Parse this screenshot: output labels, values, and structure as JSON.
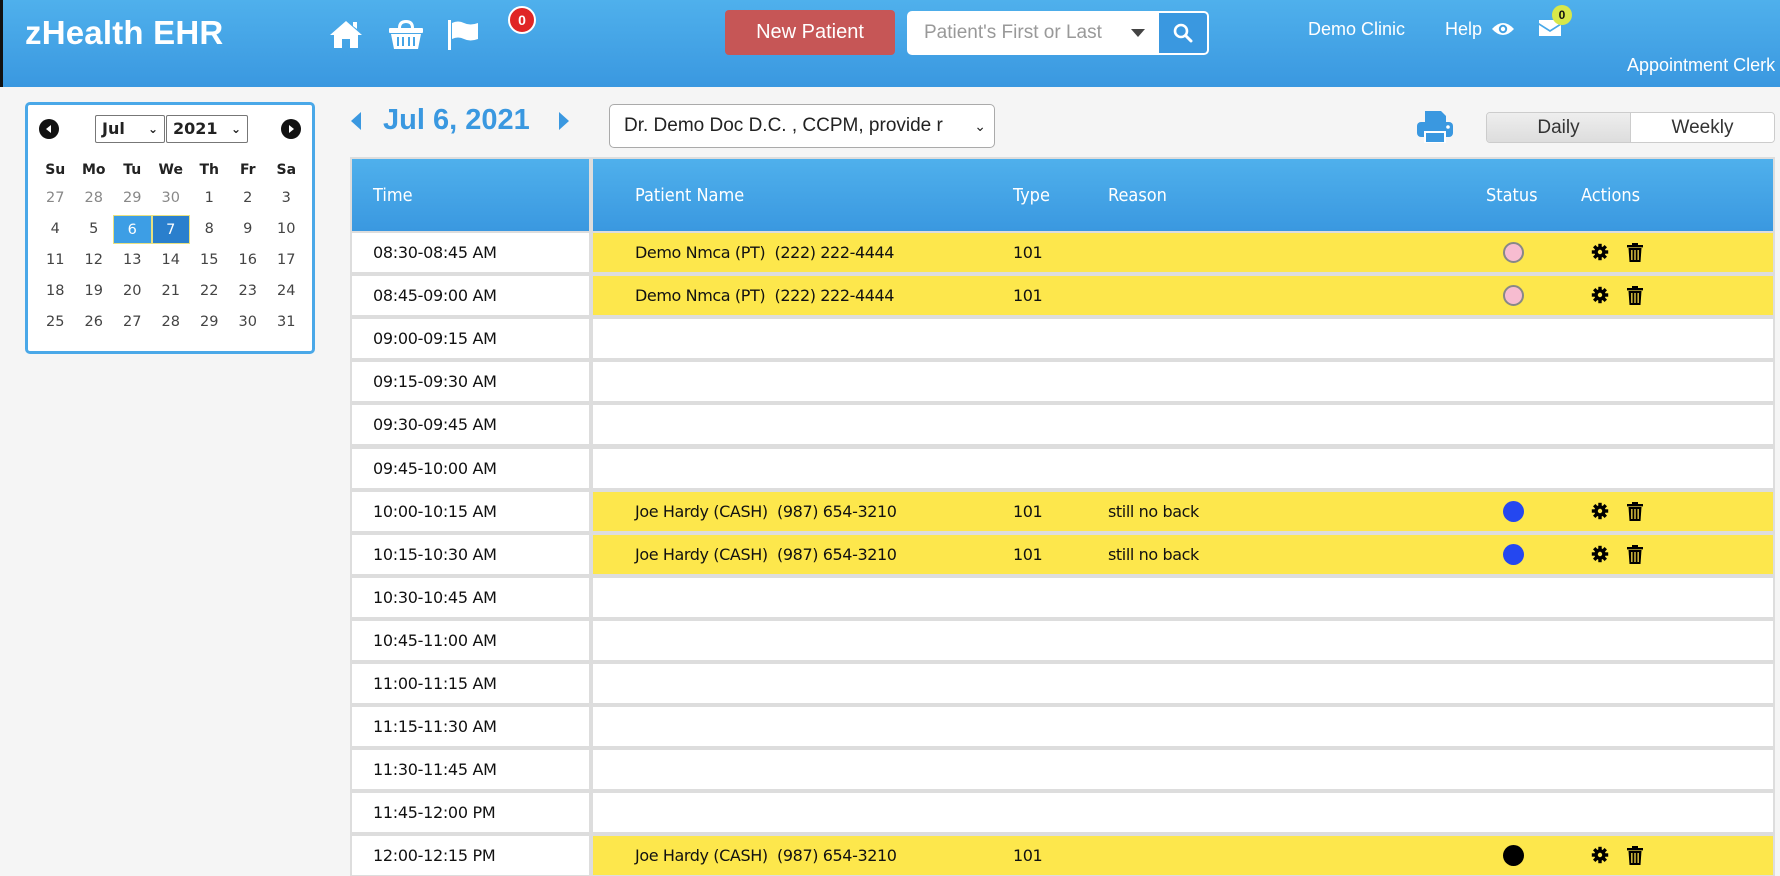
{
  "app": {
    "title": "zHealth EHR",
    "flags_badge": "0",
    "new_patient_label": "New Patient",
    "search_placeholder": "Patient's First or Last Name",
    "clinic": "Demo Clinic",
    "help": "Help",
    "messages_badge": "0",
    "role": "Appointment Clerk"
  },
  "calendar": {
    "month": "Jul",
    "year": "2021",
    "weekdays": [
      "Su",
      "Mo",
      "Tu",
      "We",
      "Th",
      "Fr",
      "Sa"
    ],
    "weeks": [
      [
        {
          "d": "27",
          "o": true
        },
        {
          "d": "28",
          "o": true
        },
        {
          "d": "29",
          "o": true
        },
        {
          "d": "30",
          "o": true
        },
        {
          "d": "1"
        },
        {
          "d": "2"
        },
        {
          "d": "3"
        }
      ],
      [
        {
          "d": "4"
        },
        {
          "d": "5"
        },
        {
          "d": "6",
          "s": "sel"
        },
        {
          "d": "7",
          "s": "today"
        },
        {
          "d": "8"
        },
        {
          "d": "9"
        },
        {
          "d": "10"
        }
      ],
      [
        {
          "d": "11"
        },
        {
          "d": "12"
        },
        {
          "d": "13"
        },
        {
          "d": "14"
        },
        {
          "d": "15"
        },
        {
          "d": "16"
        },
        {
          "d": "17"
        }
      ],
      [
        {
          "d": "18"
        },
        {
          "d": "19"
        },
        {
          "d": "20"
        },
        {
          "d": "21"
        },
        {
          "d": "22"
        },
        {
          "d": "23"
        },
        {
          "d": "24"
        }
      ],
      [
        {
          "d": "25"
        },
        {
          "d": "26"
        },
        {
          "d": "27"
        },
        {
          "d": "28"
        },
        {
          "d": "29"
        },
        {
          "d": "30"
        },
        {
          "d": "31"
        }
      ]
    ]
  },
  "schedule": {
    "date": "Jul 6, 2021",
    "provider": "Dr. Demo Doc D.C. , CCPM, provide r",
    "views": {
      "daily": "Daily",
      "weekly": "Weekly",
      "active": "Daily"
    },
    "columns": {
      "time": "Time",
      "patient": "Patient Name",
      "type": "Type",
      "reason": "Reason",
      "status": "Status",
      "actions": "Actions"
    },
    "status_colors": {
      "pink": "#f7bcd0",
      "blue": "#2447f0",
      "black": "#000000"
    },
    "rows": [
      {
        "time": "08:30-08:45 AM",
        "patient": "Demo Nmca (PT)  (222) 222-4444",
        "type": "101",
        "reason": "",
        "status": "pink"
      },
      {
        "time": "08:45-09:00 AM",
        "patient": "Demo Nmca (PT)  (222) 222-4444",
        "type": "101",
        "reason": "",
        "status": "pink"
      },
      {
        "time": "09:00-09:15 AM"
      },
      {
        "time": "09:15-09:30 AM"
      },
      {
        "time": "09:30-09:45 AM"
      },
      {
        "time": "09:45-10:00 AM"
      },
      {
        "time": "10:00-10:15 AM",
        "patient": "Joe Hardy (CASH)  (987) 654-3210",
        "type": "101",
        "reason": "still no back",
        "status": "blue"
      },
      {
        "time": "10:15-10:30 AM",
        "patient": "Joe Hardy (CASH)  (987) 654-3210",
        "type": "101",
        "reason": "still no back",
        "status": "blue"
      },
      {
        "time": "10:30-10:45 AM"
      },
      {
        "time": "10:45-11:00 AM"
      },
      {
        "time": "11:00-11:15 AM"
      },
      {
        "time": "11:15-11:30 AM"
      },
      {
        "time": "11:30-11:45 AM"
      },
      {
        "time": "11:45-12:00 PM"
      },
      {
        "time": "12:00-12:15 PM",
        "patient": "Joe Hardy (CASH)  (987) 654-3210",
        "type": "101",
        "reason": "",
        "status": "black"
      }
    ]
  }
}
